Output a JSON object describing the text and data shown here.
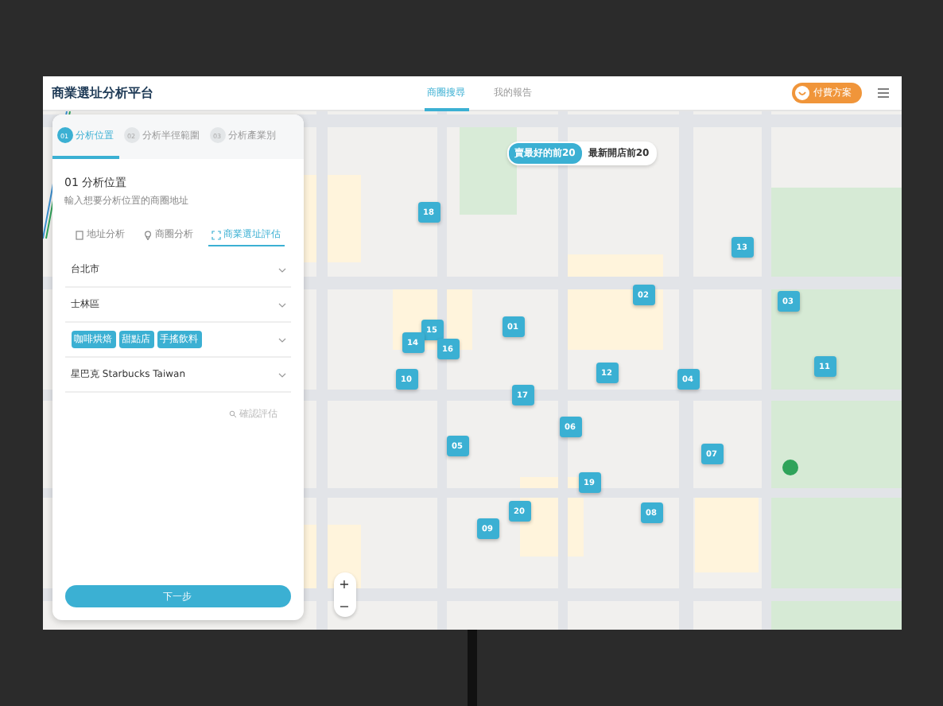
{
  "header": {
    "title": "商業選址分析平台",
    "tabs": [
      {
        "label": "商圈搜尋",
        "selected": true
      },
      {
        "label": "我的報告",
        "selected": false
      }
    ],
    "plan_button": "付費方案"
  },
  "panel": {
    "steps": [
      {
        "number": "01",
        "label": "分析位置",
        "selected": true
      },
      {
        "number": "02",
        "label": "分析半徑範圍",
        "selected": false
      },
      {
        "number": "03",
        "label": "分析產業別",
        "selected": false
      }
    ],
    "heading": "01 分析位置",
    "subtitle": "輸入想要分析位置的商圈地址",
    "tabs": [
      {
        "kind": "document",
        "label": "地址分析",
        "selected": false
      },
      {
        "kind": "pin",
        "label": "商圈分析",
        "selected": false
      },
      {
        "kind": "scan",
        "label": "商業選址評估",
        "selected": true
      }
    ],
    "fields": [
      {
        "kind": "select",
        "value": "台北市"
      },
      {
        "kind": "select",
        "value": "士林區"
      },
      {
        "kind": "tags",
        "tags": [
          "咖啡烘焙",
          "甜點店",
          "手搖飲料"
        ]
      },
      {
        "kind": "select",
        "value": "星巴克 Starbucks Taiwan"
      }
    ],
    "confirm_button": {
      "label": "確認評估",
      "disabled": true
    },
    "next_button": "下一步"
  },
  "map": {
    "toggle": [
      {
        "label": "賣最好的前20",
        "selected": true
      },
      {
        "label": "最新開店前20",
        "selected": false
      }
    ],
    "markers": [
      {
        "label": "18"
      },
      {
        "label": "13"
      },
      {
        "label": "02"
      },
      {
        "label": "03"
      },
      {
        "label": "01"
      },
      {
        "label": "15"
      },
      {
        "label": "14"
      },
      {
        "label": "16"
      },
      {
        "label": "11"
      },
      {
        "label": "12"
      },
      {
        "label": "04"
      },
      {
        "label": "10"
      },
      {
        "label": "17"
      },
      {
        "label": "06"
      },
      {
        "label": "05"
      },
      {
        "label": "07"
      },
      {
        "label": "19"
      },
      {
        "label": "20"
      },
      {
        "label": "08"
      },
      {
        "label": "09"
      }
    ],
    "zoom_in": "+",
    "zoom_out": "−"
  }
}
